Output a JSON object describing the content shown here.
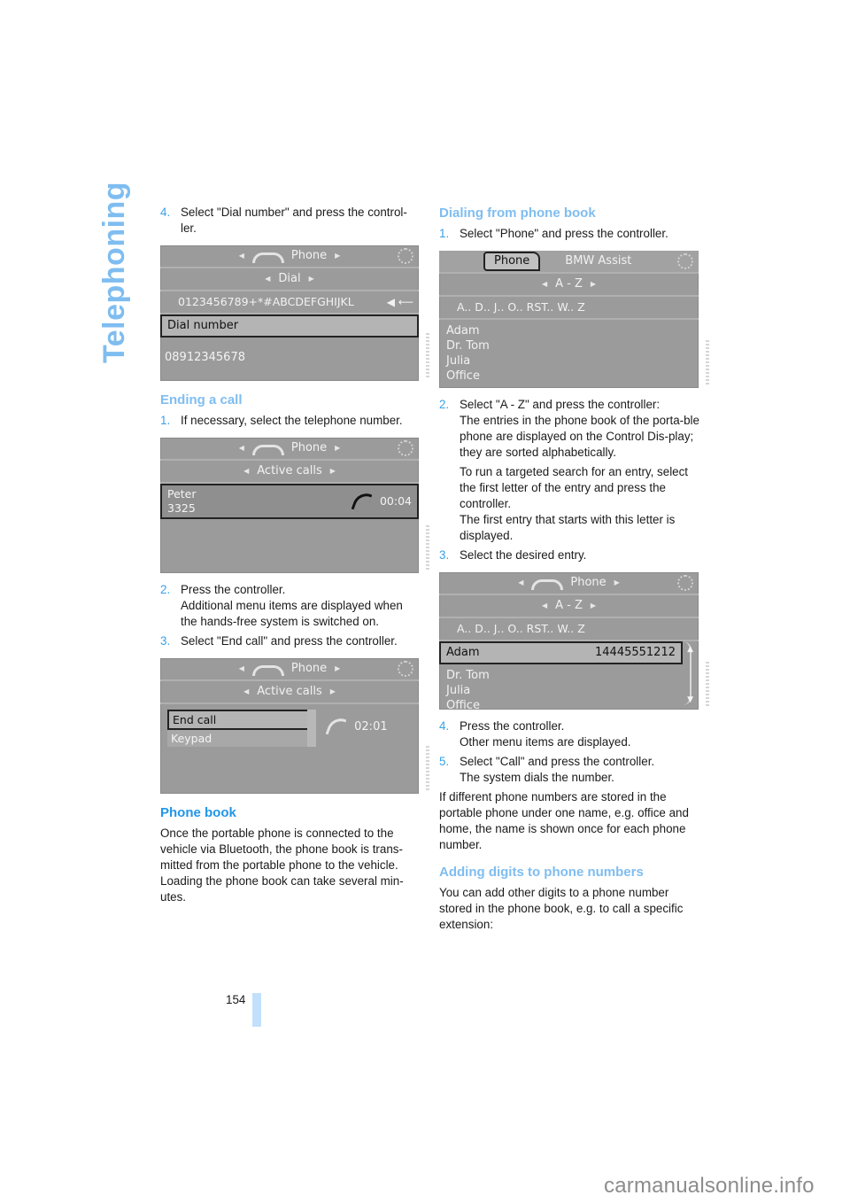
{
  "chapter_title": "Telephoning",
  "page_number": "154",
  "watermark": "carmanualsonline.info",
  "colors": {
    "accent_heading": "#7fbdf0",
    "accent_strong": "#2196e8",
    "step_number": "#3aa0e8",
    "screen_bg": "#9b9b9b"
  },
  "left_column": {
    "step4": {
      "num": "4.",
      "text": "Select \"Dial number\" and press the control-ler."
    },
    "screen_dial": {
      "menu_title": "Phone",
      "submenu": "Dial",
      "chars": "0123456789+*#ABCDEFGHIJKL",
      "char_icons": "◀ ⟵",
      "selected_item": "Dial number",
      "entered_number": "08912345678"
    },
    "ending_heading": "Ending a call",
    "end_step1": {
      "num": "1.",
      "text": "If necessary, select the telephone number."
    },
    "screen_active1": {
      "menu_title": "Phone",
      "submenu": "Active calls",
      "caller_name": "Peter",
      "caller_number": "3325",
      "duration": "00:04"
    },
    "end_step2": {
      "num": "2.",
      "line1": "Press the controller.",
      "line2": "Additional menu items are displayed when the hands-free system is switched on."
    },
    "end_step3": {
      "num": "3.",
      "text": "Select \"End call\" and press the controller."
    },
    "screen_active2": {
      "menu_title": "Phone",
      "submenu": "Active calls",
      "items": [
        "End call",
        "Keypad"
      ],
      "duration": "02:01"
    },
    "phonebook_heading": "Phone book",
    "phonebook_text": "Once the portable phone is connected to the vehicle via Bluetooth, the phone book is trans-mitted from the portable phone to the vehicle. Loading the phone book can take several min-utes."
  },
  "right_column": {
    "dialing_heading": "Dialing from phone book",
    "step1": {
      "num": "1.",
      "text": "Select \"Phone\" and press the controller."
    },
    "screen_phonebook": {
      "tabs": [
        "Phone",
        "BMW Assist"
      ],
      "submenu": "A - Z",
      "letters": "A.. D.. J.. O.. RST.. W.. Z",
      "entries": [
        "Adam",
        "Dr. Tom",
        "Julia",
        "Office"
      ]
    },
    "step2": {
      "num": "2.",
      "line1": "Select \"A - Z\" and press the controller:",
      "line2": "The entries in the phone book of the porta-ble phone are displayed on the Control Dis-play; they are sorted alphabetically.",
      "line3": "To run a targeted search for an entry, select the first letter of the entry and press the controller.",
      "line4": "The first entry that starts with this letter is displayed."
    },
    "step3": {
      "num": "3.",
      "text": "Select the desired entry."
    },
    "screen_entry": {
      "menu_title": "Phone",
      "submenu": "A - Z",
      "letters": "A.. D.. J.. O.. RST.. W.. Z",
      "selected_name": "Adam",
      "selected_number": "14445551212",
      "other_entries": [
        "Dr. Tom",
        "Julia",
        "Office"
      ]
    },
    "step4": {
      "num": "4.",
      "line1": "Press the controller.",
      "line2": "Other menu items are displayed."
    },
    "step5": {
      "num": "5.",
      "line1": "Select \"Call\" and press the controller.",
      "line2": "The system dials the number."
    },
    "multi_numbers_text": "If different phone numbers are stored in the portable phone under one name, e.g. office and home, the name is shown once for each phone number.",
    "adding_heading": "Adding digits to phone numbers",
    "adding_text": "You can add other digits to a phone number stored in the phone book, e.g. to call a specific extension:"
  }
}
